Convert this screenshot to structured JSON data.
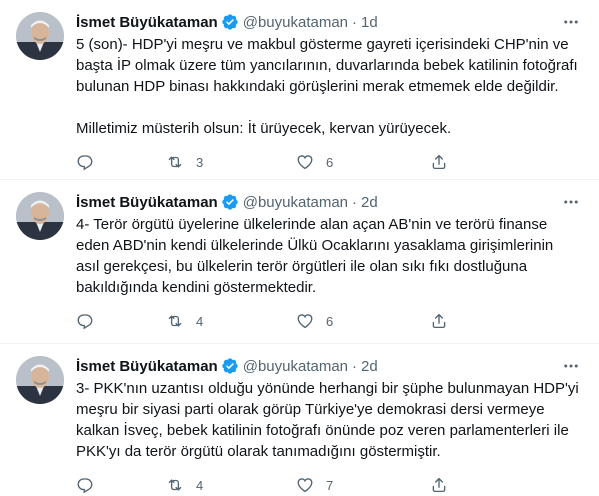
{
  "tweets": [
    {
      "author": {
        "name": "İsmet Büyükataman",
        "handle": "@buyukataman",
        "verified_icon": "verified-badge-icon"
      },
      "separator": "·",
      "time": "1d",
      "text": "5 (son)- HDP'yi meşru ve makbul gösterme gayreti içerisindeki CHP'nin ve başta İP olmak üzere tüm yancılarının, duvarlarında bebek katilinin fotoğrafı bulunan HDP binası hakkındaki görüşlerini merak etmemek elde değildir.\n\nMilletimiz müsterih olsun: İt ürüyecek, kervan yürüyecek.",
      "replies": "",
      "retweets": "3",
      "likes": "6"
    },
    {
      "author": {
        "name": "İsmet Büyükataman",
        "handle": "@buyukataman",
        "verified_icon": "verified-badge-icon"
      },
      "separator": "·",
      "time": "2d",
      "text": "4- Terör örgütü üyelerine ülkelerinde alan açan AB'nin ve terörü finanse eden ABD'nin kendi ülkelerinde Ülkü Ocaklarını yasaklama girişimlerinin asıl gerekçesi, bu ülkelerin terör örgütleri ile olan sıkı fıkı dostluğuna bakıldığında kendini göstermektedir.",
      "replies": "",
      "retweets": "4",
      "likes": "6"
    },
    {
      "author": {
        "name": "İsmet Büyükataman",
        "handle": "@buyukataman",
        "verified_icon": "verified-badge-icon"
      },
      "separator": "·",
      "time": "2d",
      "text": "3- PKK'nın uzantısı olduğu yönünde herhangi bir şüphe bulunmayan HDP'yi meşru bir siyasi parti olarak görüp Türkiye'ye demokrasi dersi vermeye kalkan İsveç, bebek katilinin fotoğrafı önünde poz veren parlamenterleri ile PKK'yı da terör örgütü olarak tanımadığını göstermiştir.",
      "replies": "",
      "retweets": "4",
      "likes": "7"
    }
  ],
  "colors": {
    "accent": "#1d9bf0",
    "muted": "#536471",
    "text": "#0f1419",
    "divider": "#eff3f4"
  }
}
